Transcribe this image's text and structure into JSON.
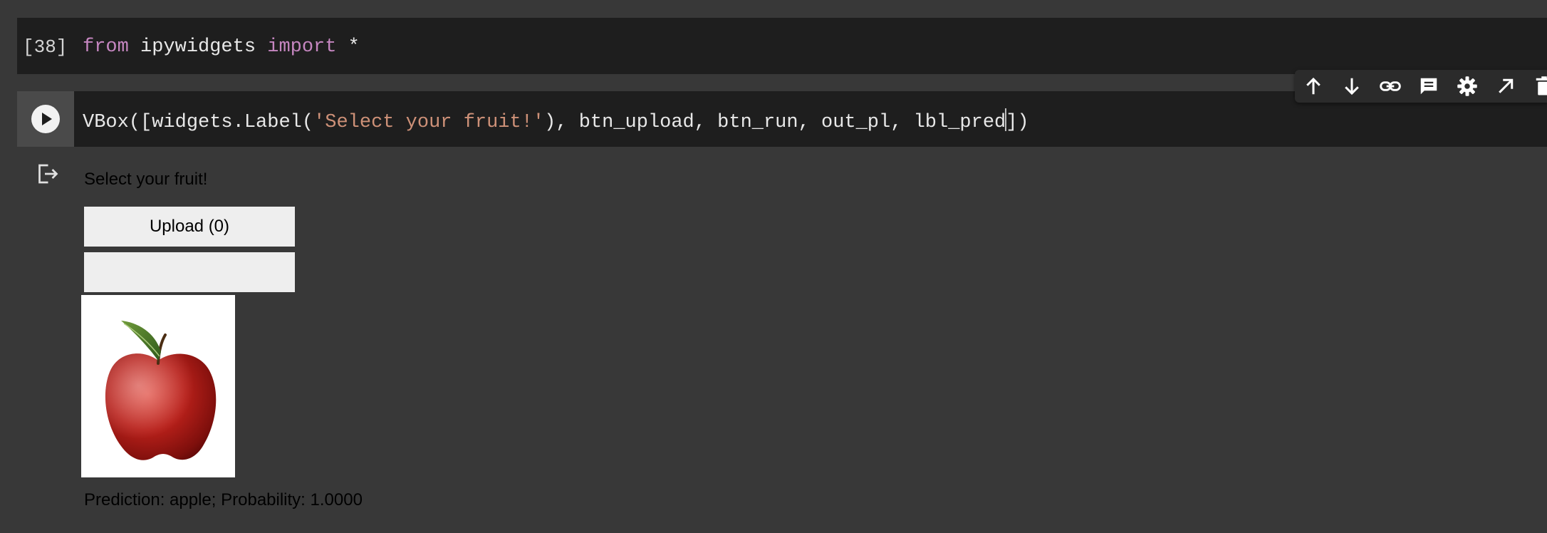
{
  "cell1": {
    "exec_count": "[38]",
    "code": {
      "kw_from": "from",
      "module": " ipywidgets ",
      "kw_import": "import",
      "rest": " *"
    }
  },
  "cell2": {
    "code": {
      "part1": "VBox([widgets.Label(",
      "string": "'Select your fruit!'",
      "part2": "), btn_upload, btn_run, out_pl, lbl_pred",
      "part3": "])"
    }
  },
  "toolbar": {
    "icons": [
      "arrow-up-icon",
      "arrow-down-icon",
      "link-icon",
      "comment-icon",
      "gear-icon",
      "open-external-icon",
      "delete-icon"
    ]
  },
  "output": {
    "label": "Select your fruit!",
    "upload_button": "Upload (0)",
    "image": "apple",
    "prediction": "Prediction: apple; Probability: 1.0000"
  },
  "colors": {
    "background": "#383838",
    "code_bg": "#1e1e1e",
    "keyword": "#c586c0",
    "string": "#ce9178",
    "widget_button": "#eeeeee"
  }
}
